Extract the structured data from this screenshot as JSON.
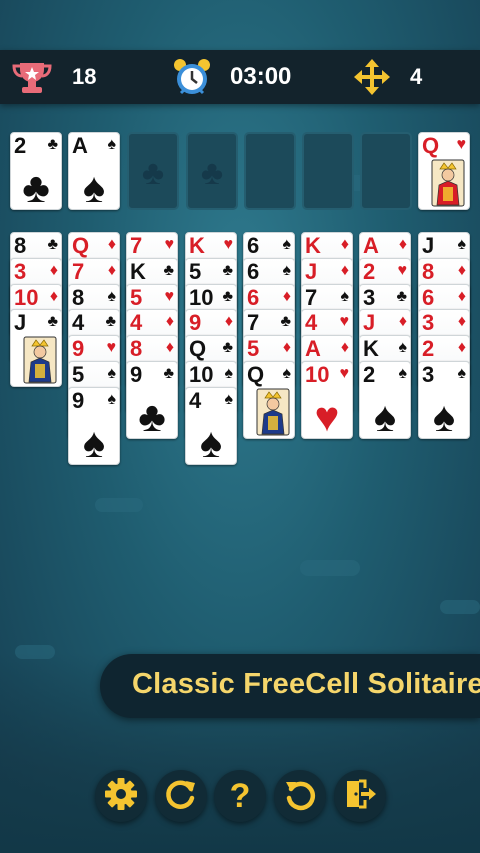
{
  "header": {
    "score": "18",
    "timer": "03:00",
    "moves": "4",
    "icons": [
      "trophy-icon",
      "alarm-clock-icon",
      "move-arrows-icon"
    ]
  },
  "free_cells": [
    {
      "rank": "2",
      "suit": "♣",
      "color": "black"
    },
    {
      "rank": "A",
      "suit": "♠",
      "color": "black"
    },
    {
      "empty": true,
      "hint": "♣"
    },
    {
      "empty": true,
      "hint": "♣"
    }
  ],
  "foundations": [
    {
      "empty": true
    },
    {
      "empty": true
    },
    {
      "empty": true
    },
    {
      "rank": "Q",
      "suit": "♥",
      "color": "red",
      "face": true
    }
  ],
  "tableau": [
    [
      {
        "rank": "8",
        "suit": "♣"
      },
      {
        "rank": "3",
        "suit": "♦"
      },
      {
        "rank": "10",
        "suit": "♦"
      },
      {
        "rank": "J",
        "suit": "♣",
        "face": true
      }
    ],
    [
      {
        "rank": "Q",
        "suit": "♦"
      },
      {
        "rank": "7",
        "suit": "♦"
      },
      {
        "rank": "8",
        "suit": "♠"
      },
      {
        "rank": "4",
        "suit": "♣"
      },
      {
        "rank": "9",
        "suit": "♥"
      },
      {
        "rank": "5",
        "suit": "♠"
      },
      {
        "rank": "9",
        "suit": "♠"
      }
    ],
    [
      {
        "rank": "7",
        "suit": "♥"
      },
      {
        "rank": "K",
        "suit": "♣"
      },
      {
        "rank": "5",
        "suit": "♥"
      },
      {
        "rank": "4",
        "suit": "♦"
      },
      {
        "rank": "8",
        "suit": "♦"
      },
      {
        "rank": "9",
        "suit": "♣"
      }
    ],
    [
      {
        "rank": "K",
        "suit": "♥"
      },
      {
        "rank": "5",
        "suit": "♣"
      },
      {
        "rank": "10",
        "suit": "♣"
      },
      {
        "rank": "9",
        "suit": "♦"
      },
      {
        "rank": "Q",
        "suit": "♣"
      },
      {
        "rank": "10",
        "suit": "♠"
      },
      {
        "rank": "4",
        "suit": "♠"
      }
    ],
    [
      {
        "rank": "6",
        "suit": "♠"
      },
      {
        "rank": "6",
        "suit": "♠"
      },
      {
        "rank": "6",
        "suit": "♦"
      },
      {
        "rank": "7",
        "suit": "♣"
      },
      {
        "rank": "5",
        "suit": "♦"
      },
      {
        "rank": "Q",
        "suit": "♠",
        "face": true
      }
    ],
    [
      {
        "rank": "K",
        "suit": "♦"
      },
      {
        "rank": "J",
        "suit": "♦"
      },
      {
        "rank": "7",
        "suit": "♠"
      },
      {
        "rank": "4",
        "suit": "♥"
      },
      {
        "rank": "A",
        "suit": "♦"
      },
      {
        "rank": "10",
        "suit": "♥"
      }
    ],
    [
      {
        "rank": "A",
        "suit": "♦"
      },
      {
        "rank": "2",
        "suit": "♥"
      },
      {
        "rank": "3",
        "suit": "♣"
      },
      {
        "rank": "J",
        "suit": "♦"
      },
      {
        "rank": "K",
        "suit": "♠"
      },
      {
        "rank": "2",
        "suit": "♠"
      }
    ],
    [
      {
        "rank": "J",
        "suit": "♠"
      },
      {
        "rank": "8",
        "suit": "♦"
      },
      {
        "rank": "6",
        "suit": "♦"
      },
      {
        "rank": "3",
        "suit": "♦"
      },
      {
        "rank": "2",
        "suit": "♦"
      },
      {
        "rank": "3",
        "suit": "♠"
      }
    ]
  ],
  "banner": {
    "text": "Classic FreeCell Solitaire"
  },
  "toolbar": {
    "buttons": [
      "settings-gear-icon",
      "restart-icon",
      "help-icon",
      "undo-icon",
      "exit-door-icon"
    ]
  },
  "colors": {
    "red_suit": "#d81e27",
    "black_suit": "#111111",
    "banner_text": "#f5d66b",
    "accent_yellow": "#f4c430"
  }
}
